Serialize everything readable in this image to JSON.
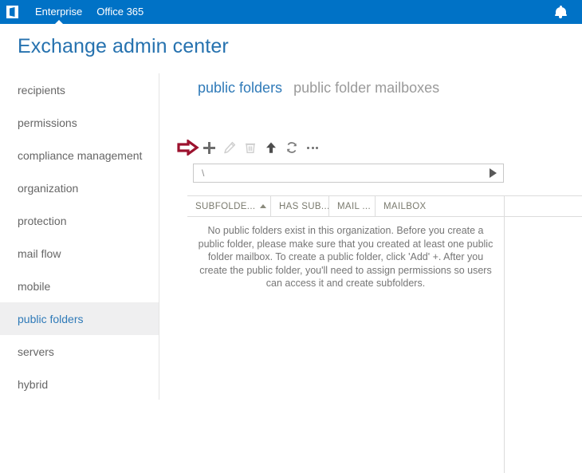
{
  "suite_bar": {
    "logo_icon": "office-logo-icon",
    "links": [
      {
        "label": "Enterprise",
        "active": true
      },
      {
        "label": "Office 365",
        "active": false
      }
    ],
    "notification_icon": "bell-icon",
    "background_color": "#0072c6"
  },
  "page": {
    "title": "Exchange admin center",
    "title_color": "#2672af"
  },
  "sidebar": {
    "items": [
      {
        "label": "recipients",
        "selected": false
      },
      {
        "label": "permissions",
        "selected": false
      },
      {
        "label": "compliance management",
        "selected": false
      },
      {
        "label": "organization",
        "selected": false
      },
      {
        "label": "protection",
        "selected": false
      },
      {
        "label": "mail flow",
        "selected": false
      },
      {
        "label": "mobile",
        "selected": false
      },
      {
        "label": "public folders",
        "selected": true
      },
      {
        "label": "servers",
        "selected": false
      },
      {
        "label": "hybrid",
        "selected": false
      }
    ],
    "selected_bg": "#efeff0",
    "selected_color": "#2f7ab8"
  },
  "main": {
    "tabs": [
      {
        "label": "public folders",
        "active": true
      },
      {
        "label": "public folder mailboxes",
        "active": false
      }
    ],
    "toolbar": {
      "annotation": {
        "icon": "red-arrow-annotation",
        "color": "#9c122e",
        "points_to": "add-button"
      },
      "buttons": [
        {
          "name": "add-button",
          "icon": "plus-icon",
          "label": "Add",
          "enabled": true
        },
        {
          "name": "edit-button",
          "icon": "pencil-icon",
          "label": "Edit",
          "enabled": false
        },
        {
          "name": "delete-button",
          "icon": "trash-icon",
          "label": "Delete",
          "enabled": false
        },
        {
          "name": "move-up-button",
          "icon": "up-arrow-icon",
          "label": "Up",
          "enabled": true
        },
        {
          "name": "refresh-button",
          "icon": "refresh-icon",
          "label": "Refresh",
          "enabled": true
        },
        {
          "name": "more-button",
          "icon": "ellipsis-icon",
          "label": "More options",
          "enabled": true
        }
      ]
    },
    "path_bar": {
      "value": "\\",
      "placeholder": "\\",
      "go_icon": "play-triangle-icon"
    },
    "table": {
      "columns": [
        {
          "label": "SUBFOLDE...",
          "sorted": "asc"
        },
        {
          "label": "HAS SUB...",
          "sorted": ""
        },
        {
          "label": "MAIL ...",
          "sorted": ""
        },
        {
          "label": "MAILBOX",
          "sorted": ""
        }
      ],
      "rows": [],
      "empty_message": "No public folders exist in this organization. Before you create a public folder, please make sure that you created at least one public folder mailbox. To create a public folder, click 'Add' +. After you create the public folder, you'll need to assign permissions so users can access it and create subfolders."
    }
  }
}
